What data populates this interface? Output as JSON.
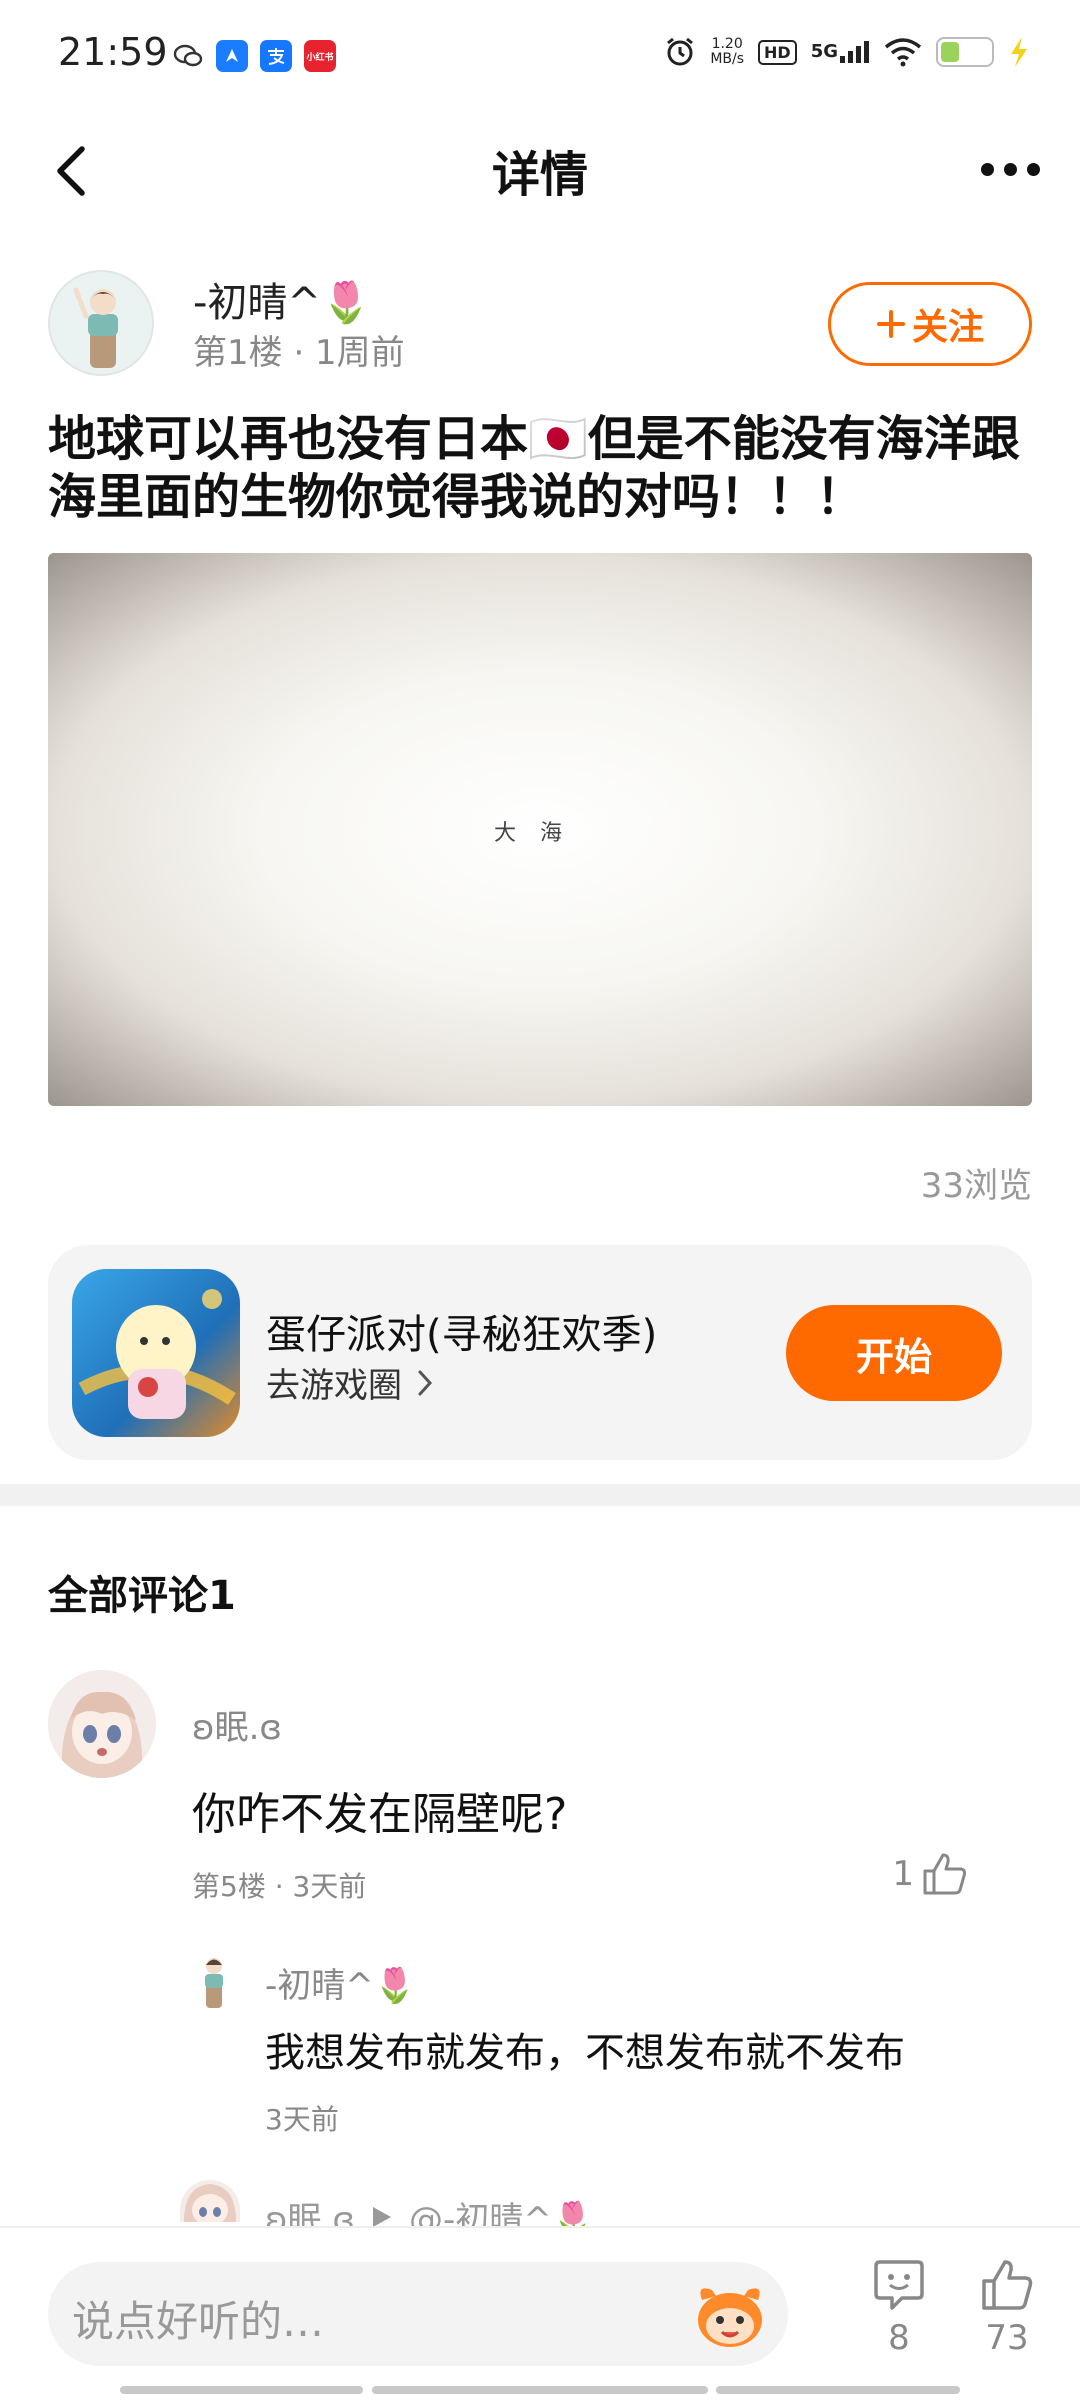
{
  "status_bar": {
    "time": "21:59",
    "speed_value": "1.20",
    "speed_unit": "MB/s",
    "hd": "HD",
    "network": "5G",
    "app_icons": [
      "wechat-icon",
      "maps-icon",
      "alipay-icon",
      "xiaohongshu-icon"
    ],
    "app_icon_label_4": "小红书"
  },
  "nav": {
    "title": "详情"
  },
  "post": {
    "author": "-初晴^🌷",
    "meta": "第1楼 · 1周前",
    "follow_label": "关注",
    "text": "地球可以再也没有日本🇯🇵但是不能没有海洋跟海里面的生物你觉得我说的对吗！！！",
    "image_caption": "大海",
    "views": "33浏览"
  },
  "game_card": {
    "name": "蛋仔派对(寻秘狂欢季)",
    "sub_label": "去游戏圈",
    "button_label": "开始"
  },
  "comments": {
    "title": "全部评论1",
    "items": [
      {
        "name": "ʚ眠.ɞ",
        "text": "你咋不发在隔壁呢?",
        "meta": "第5楼 · 3天前",
        "likes": "1",
        "replies": [
          {
            "name": "-初晴^🌷",
            "text": "我想发布就发布，不想发布就不发布",
            "time": "3天前"
          },
          {
            "name": "ʚ眠.ɞ",
            "reply_to": "@-初晴^🌷"
          }
        ]
      }
    ]
  },
  "bottom_bar": {
    "placeholder": "说点好听的…",
    "comment_count": "8",
    "like_count": "73"
  },
  "colors": {
    "accent": "#ff6a00",
    "text_secondary": "#888888",
    "card_bg": "#f4f4f4"
  }
}
